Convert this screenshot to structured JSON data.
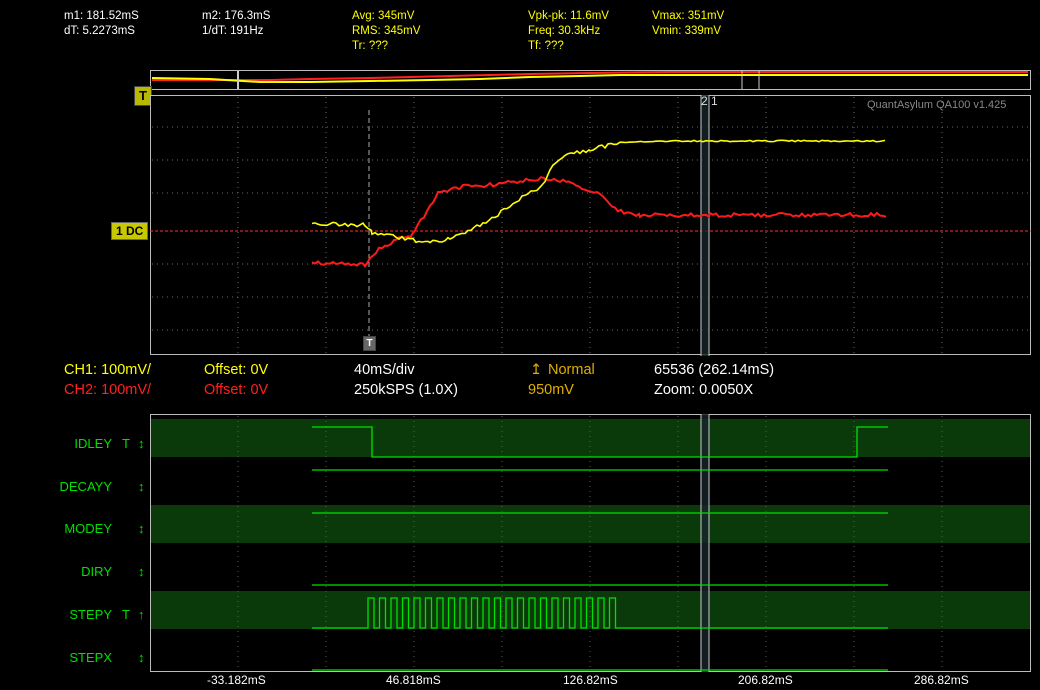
{
  "measurements": {
    "m1": "m1: 181.52mS",
    "dT": "dT: 5.2273mS",
    "m2": "m2: 176.3mS",
    "inv_dT": "1/dT: 191Hz",
    "avg": "Avg: 345mV",
    "rms": "RMS: 345mV",
    "tr": "Tr: ???",
    "vpkpk": "Vpk-pk: 11.6mV",
    "freq": "Freq: 30.3kHz",
    "tf": "Tf: ???",
    "vmax": "Vmax: 351mV",
    "vmin": "Vmin: 339mV"
  },
  "scope": {
    "trigger_badge": "T",
    "cursor_labels": "2 1",
    "watermark": "QuantAsylum QA100 v1.425",
    "channel_badge": "1 DC",
    "trigger_marker": "T"
  },
  "settings": {
    "ch1_scale": "CH1: 100mV/",
    "ch1_offset": "Offset: 0V",
    "ch2_scale": "CH2: 100mV/",
    "ch2_offset": "Offset: 0V",
    "timebase": "40mS/div",
    "sample_rate": "250kSPS (1.0X)",
    "trigger_icon": "trigger-rising-icon",
    "trigger_mode": "Normal",
    "trigger_level": "950mV",
    "samples": "65536 (262.14mS)",
    "zoom": "Zoom: 0.0050X"
  },
  "logic_channels": [
    {
      "name": "IDLEY",
      "trigger": "T",
      "edge": "↕"
    },
    {
      "name": "DECAYY",
      "trigger": "",
      "edge": "↕"
    },
    {
      "name": "MODEY",
      "trigger": "",
      "edge": "↕"
    },
    {
      "name": "DIRY",
      "trigger": "",
      "edge": "↕"
    },
    {
      "name": "STEPY",
      "trigger": "T",
      "edge": "↑"
    },
    {
      "name": "STEPX",
      "trigger": "",
      "edge": "↕"
    }
  ],
  "time_axis": [
    "-33.182mS",
    "46.818mS",
    "126.82mS",
    "206.82mS",
    "286.82mS"
  ],
  "colors": {
    "ch1": "#ffff00",
    "ch2": "#ff2020",
    "logic": "#00e000",
    "logic_band": "#0a3a0a",
    "grid": "#5a5a5a"
  }
}
